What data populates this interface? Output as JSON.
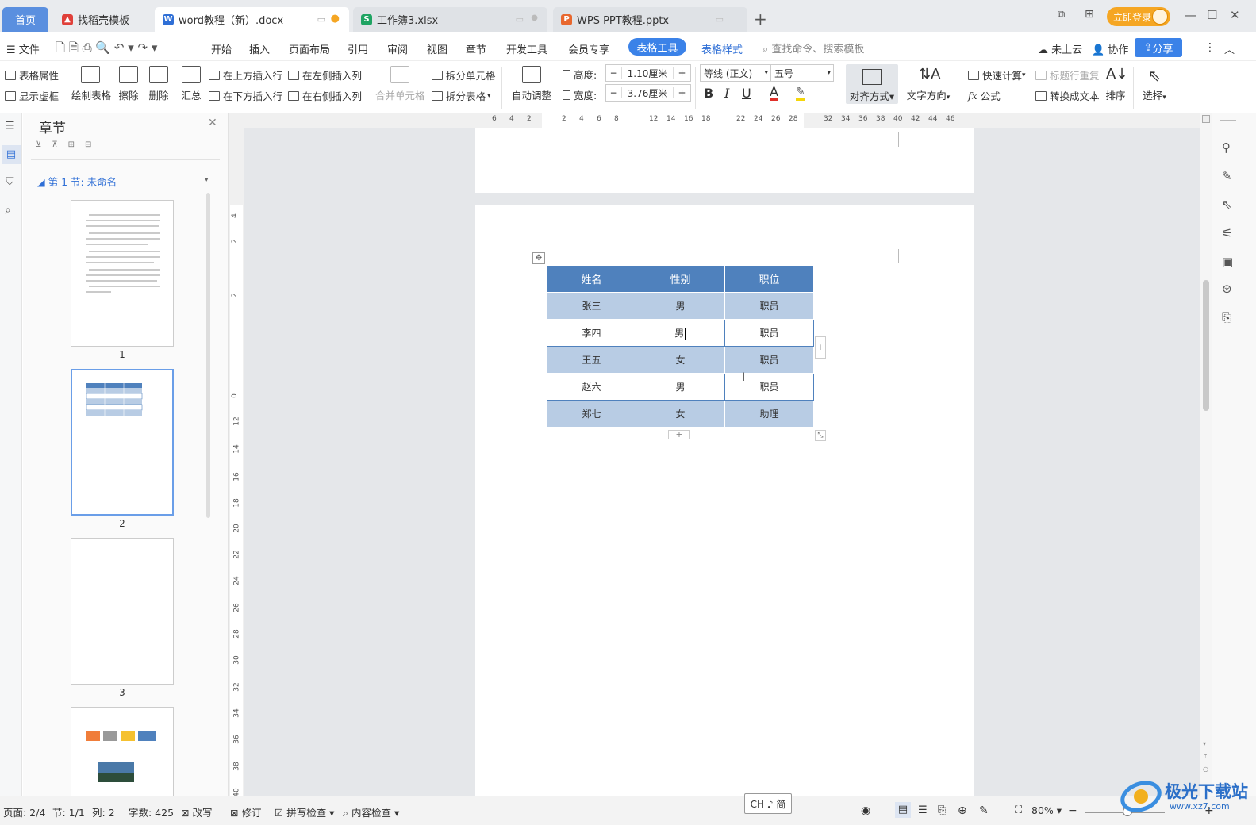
{
  "tabs": [
    {
      "label": "首页",
      "icon": "home"
    },
    {
      "label": "找稻壳模板",
      "icon": "docer-icon"
    },
    {
      "label": "word教程（新）.docx",
      "icon": "word-icon"
    },
    {
      "label": "工作簿3.xlsx",
      "icon": "excel-icon"
    },
    {
      "label": "WPS PPT教程.pptx",
      "icon": "ppt-icon"
    }
  ],
  "titlebar": {
    "login": "立即登录"
  },
  "menubar": {
    "file": "文件",
    "items": [
      "开始",
      "插入",
      "页面布局",
      "引用",
      "审阅",
      "视图",
      "章节",
      "开发工具",
      "会员专享"
    ],
    "active": "表格工具",
    "table_style": "表格样式",
    "search": "查找命令、搜索模板",
    "cloud": "未上云",
    "collab": "协作",
    "share": "分享"
  },
  "ribbon": {
    "table_props": "表格属性",
    "show_grid": "显示虚框",
    "draw_table": "绘制表格",
    "erase": "擦除",
    "delete": "删除",
    "summary": "汇总",
    "insert_above": "在上方插入行",
    "insert_below": "在下方插入行",
    "insert_left": "在左侧插入列",
    "insert_right": "在右侧插入列",
    "merge_cells": "合并单元格",
    "split_cells": "拆分单元格",
    "split_table": "拆分表格",
    "auto_adjust": "自动调整",
    "height_label": "高度:",
    "height_value": "1.10厘米",
    "width_label": "宽度:",
    "width_value": "3.76厘米",
    "font": "等线 (正文)",
    "size": "五号",
    "bold": "B",
    "italic": "I",
    "underline": "U",
    "font_color": "A",
    "align": "对齐方式",
    "text_dir": "文字方向",
    "quick_calc": "快速计算",
    "title_repeat": "标题行重复",
    "formula": "公式",
    "convert_text": "转换成文本",
    "sort": "排序",
    "select": "选择"
  },
  "nav": {
    "title": "章节",
    "section": "第 1 节: 未命名",
    "pages": [
      "1",
      "2",
      "3"
    ]
  },
  "ruler": {
    "h_ticks": [
      "6",
      "4",
      "2",
      "2",
      "4",
      "6",
      "8",
      "12",
      "14",
      "16",
      "18",
      "22",
      "24",
      "26",
      "28",
      "32",
      "34",
      "36",
      "38",
      "40",
      "42",
      "44",
      "46"
    ],
    "v_ticks": [
      "4",
      "2",
      "2",
      "0",
      "12",
      "14",
      "16",
      "18",
      "20",
      "22",
      "24",
      "26",
      "28",
      "30",
      "32",
      "34",
      "36",
      "38",
      "40"
    ]
  },
  "table": {
    "headers": [
      "姓名",
      "性别",
      "职位"
    ],
    "rows": [
      [
        "张三",
        "男",
        "职员"
      ],
      [
        "李四",
        "男",
        "职员"
      ],
      [
        "王五",
        "女",
        "职员"
      ],
      [
        "赵六",
        "男",
        "职员"
      ],
      [
        "郑七",
        "女",
        "助理"
      ]
    ]
  },
  "status": {
    "page": "页面: 2/4",
    "section": "节: 1/1",
    "col": "列: 2",
    "words": "字数: 425",
    "rewrite": "改写",
    "revise": "修订",
    "spell": "拼写检查",
    "content": "内容检查",
    "zoom": "80%",
    "ime": "CH ♪ 简"
  },
  "watermark": {
    "title": "极光下载站",
    "url": "www.xz7.com"
  },
  "colors": {
    "accent": "#3b82e8",
    "table_header": "#4f81bd",
    "table_band": "#b8cce4",
    "login": "#f5a623"
  }
}
